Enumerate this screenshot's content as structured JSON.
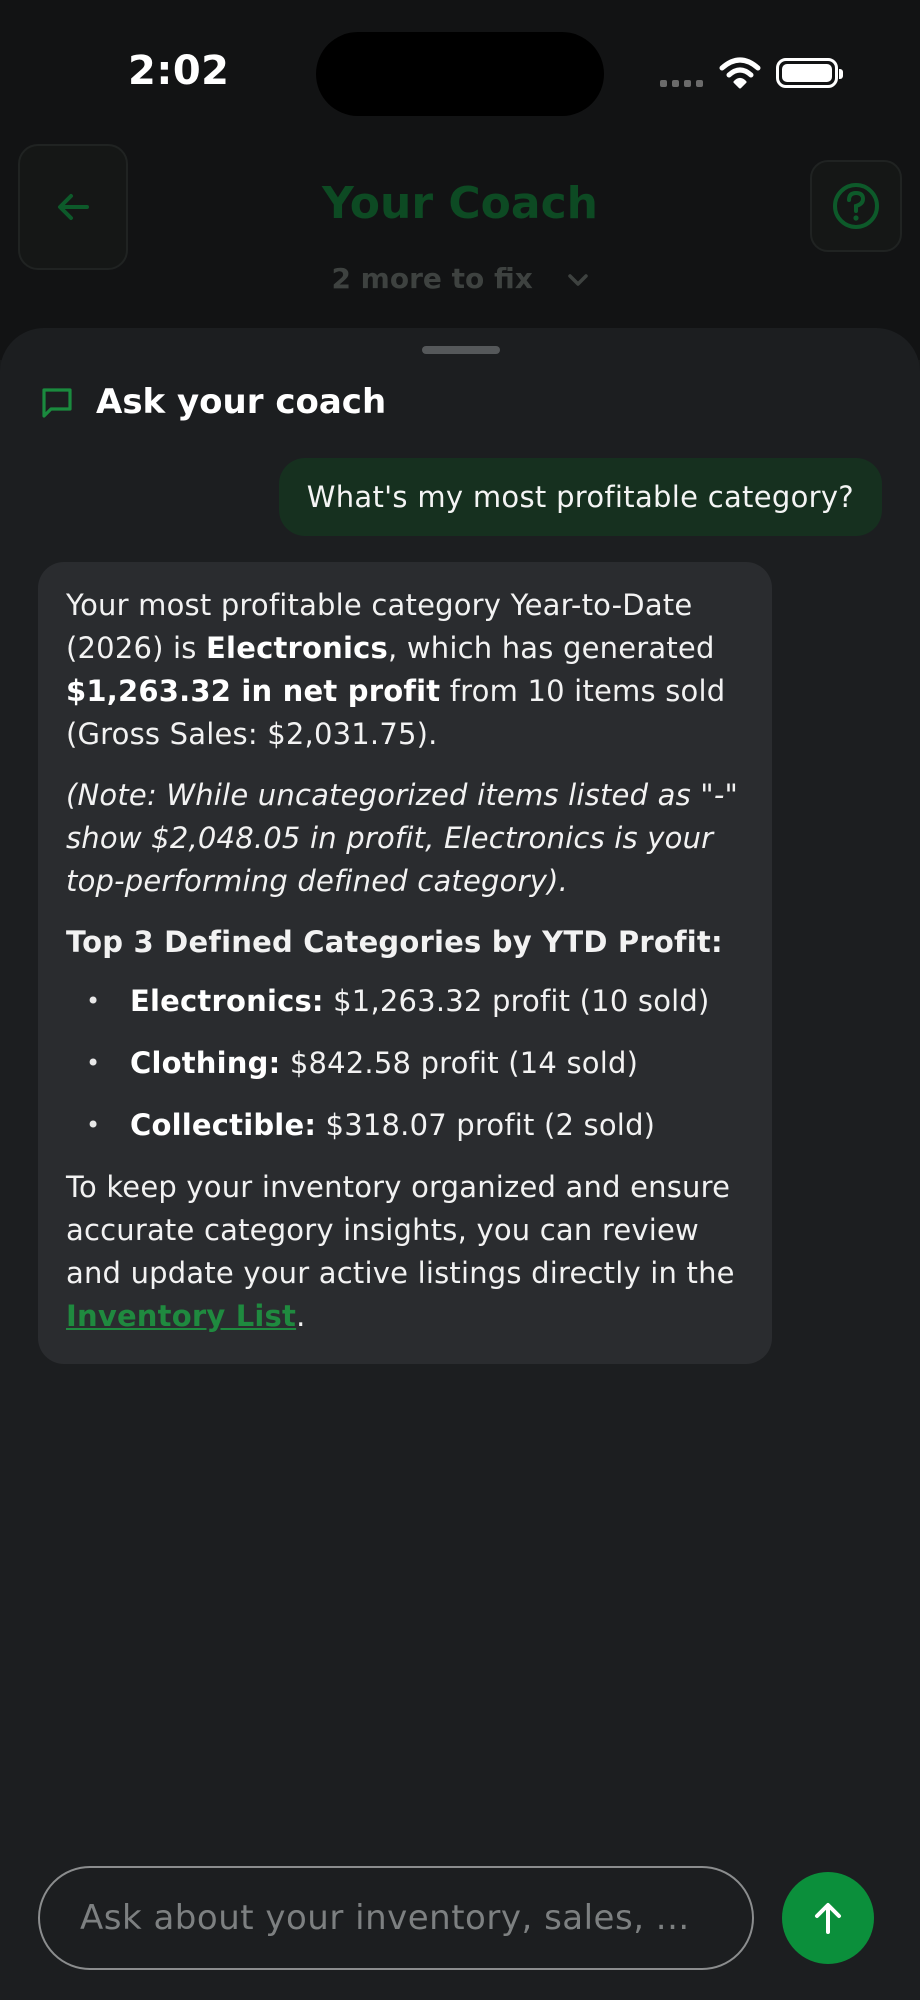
{
  "status_bar": {
    "time": "2:02"
  },
  "header": {
    "title": "Your Coach",
    "subtitle": "2 more to fix"
  },
  "sheet": {
    "title": "Ask your coach"
  },
  "chat": {
    "user_message": "What's my most profitable category?",
    "reply": {
      "p1_a": "Your most profitable category Year-to-Date (2026) is ",
      "p1_b": "Electronics",
      "p1_c": ", which has generated ",
      "p1_d": "$1,263.32 in net profit",
      "p1_e": " from 10 items sold (Gross Sales: $2,031.75).",
      "note": "(Note: While uncategorized items listed as \"-\" show $2,048.05 in profit, Electronics is your top-performing defined category).",
      "list_title": "Top 3 Defined Categories by YTD Profit:",
      "items": [
        {
          "name": "Electronics:",
          "detail": " $1,263.32 profit (10 sold)"
        },
        {
          "name": "Clothing:",
          "detail": " $842.58 profit (14 sold)"
        },
        {
          "name": "Collectible:",
          "detail": " $318.07 profit (2 sold)"
        }
      ],
      "closing_text": "To keep your inventory organized and ensure accurate category insights, you can review and update your active listings directly in the ",
      "link_text": "Inventory List",
      "closing_end": "."
    }
  },
  "composer": {
    "placeholder": "Ask about your inventory, sales, ..."
  },
  "colors": {
    "accent": "#0b8f3b",
    "link": "#1f8a3f",
    "user_bubble": "#16301f",
    "ai_bubble": "#2a2c2f"
  },
  "icons": {
    "back": "arrow-left-icon",
    "help": "question-circle-icon",
    "chat": "message-square-icon",
    "send": "arrow-up-icon",
    "chevron": "chevron-down-icon"
  }
}
